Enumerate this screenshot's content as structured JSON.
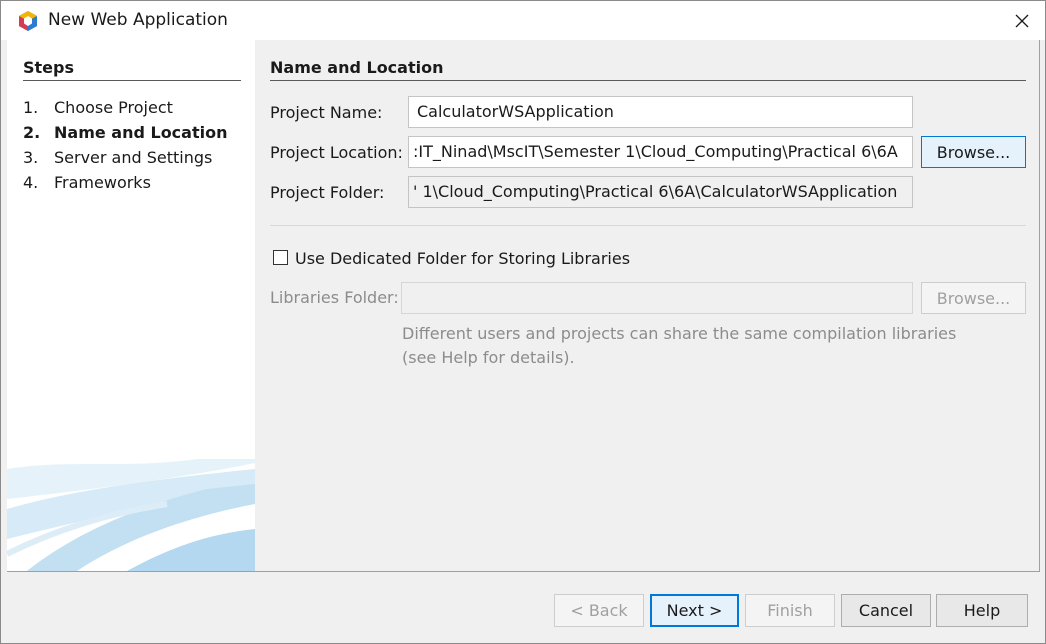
{
  "window": {
    "title": "New Web Application"
  },
  "steps": {
    "title": "Steps",
    "items": [
      {
        "num": "1.",
        "label": "Choose Project"
      },
      {
        "num": "2.",
        "label": "Name and Location"
      },
      {
        "num": "3.",
        "label": "Server and Settings"
      },
      {
        "num": "4.",
        "label": "Frameworks"
      }
    ],
    "current_index": 1
  },
  "section": {
    "title": "Name and Location"
  },
  "form": {
    "project_name_label": "Project Name:",
    "project_name_value": "CalculatorWSApplication",
    "project_location_label": "Project Location:",
    "project_location_value": ":IT_Ninad\\MscIT\\Semester 1\\Cloud_Computing\\Practical 6\\6A",
    "browse_label": "Browse...",
    "project_folder_label": "Project Folder:",
    "project_folder_value": "' 1\\Cloud_Computing\\Practical 6\\6A\\CalculatorWSApplication",
    "dedicated_folder_label": "Use Dedicated Folder for Storing Libraries",
    "dedicated_folder_checked": false,
    "libraries_folder_label": "Libraries Folder:",
    "libraries_folder_value": "",
    "libraries_browse_label": "Browse...",
    "help_text": "Different users and projects can share the same compilation libraries (see Help for details)."
  },
  "footer": {
    "back_label": "< Back",
    "next_label": "Next >",
    "finish_label": "Finish",
    "cancel_label": "Cancel",
    "help_label": "Help"
  },
  "colors": {
    "accent": "#0078d7",
    "muted_text": "#8c8c8c"
  },
  "icons": {
    "app": "netbeans-cube-icon",
    "close": "close-icon"
  }
}
